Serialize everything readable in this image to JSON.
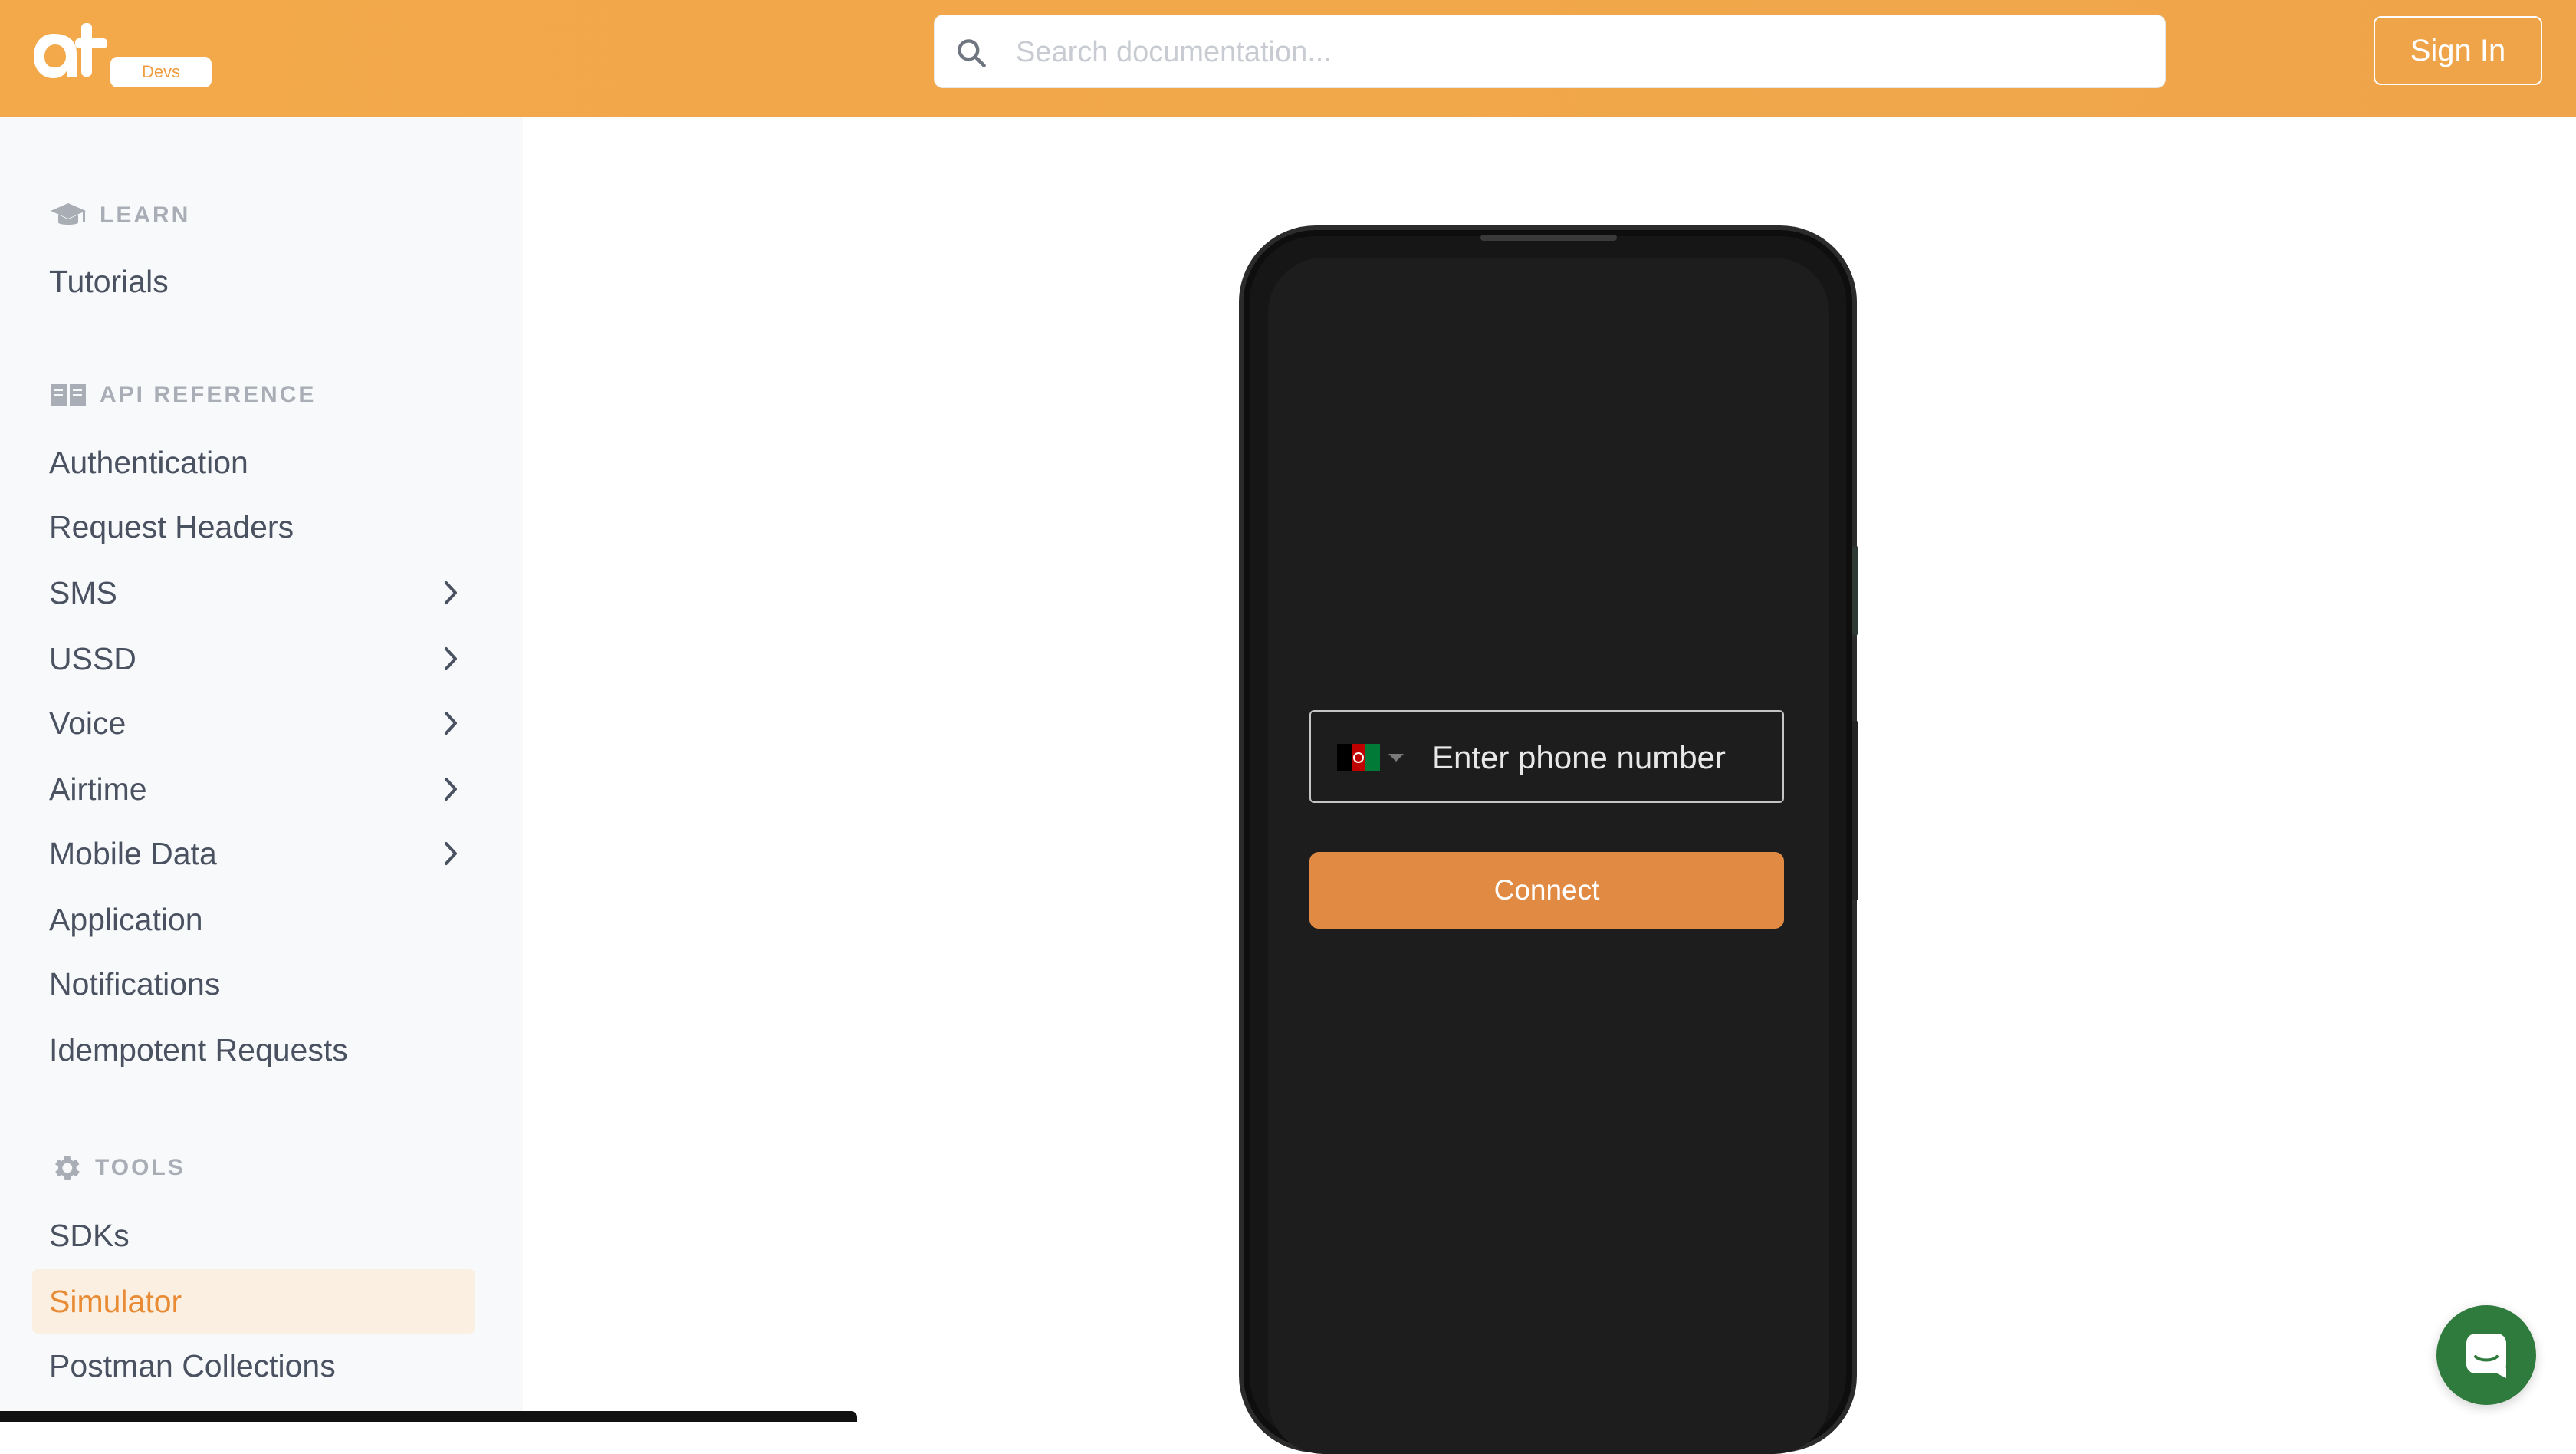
{
  "header": {
    "logo_badge": "Devs",
    "search_placeholder": "Search documentation...",
    "sign_in_label": "Sign In"
  },
  "sidebar": {
    "learn": {
      "header": "LEARN",
      "icon": "graduation-cap-icon",
      "items": [
        "Tutorials"
      ]
    },
    "api_reference": {
      "header": "API REFERENCE",
      "icon": "book-icon",
      "items": [
        {
          "label": "Authentication",
          "expandable": false
        },
        {
          "label": "Request Headers",
          "expandable": false
        },
        {
          "label": "SMS",
          "expandable": true
        },
        {
          "label": "USSD",
          "expandable": true
        },
        {
          "label": "Voice",
          "expandable": true
        },
        {
          "label": "Airtime",
          "expandable": true
        },
        {
          "label": "Mobile Data",
          "expandable": true
        },
        {
          "label": "Application",
          "expandable": false
        },
        {
          "label": "Notifications",
          "expandable": false
        },
        {
          "label": "Idempotent Requests",
          "expandable": false
        }
      ]
    },
    "tools": {
      "header": "TOOLS",
      "icon": "gear-icon",
      "items": [
        "SDKs",
        "Simulator",
        "Postman Collections"
      ],
      "active": "Simulator"
    }
  },
  "simulator": {
    "phone_placeholder": "Enter phone number",
    "country_flag": "afghanistan-flag-icon",
    "connect_label": "Connect"
  },
  "colors": {
    "header_bg": "#f1a84a",
    "accent": "#e18a43",
    "active_bg": "#fbefe1",
    "chat_button": "#2f7a3d"
  }
}
